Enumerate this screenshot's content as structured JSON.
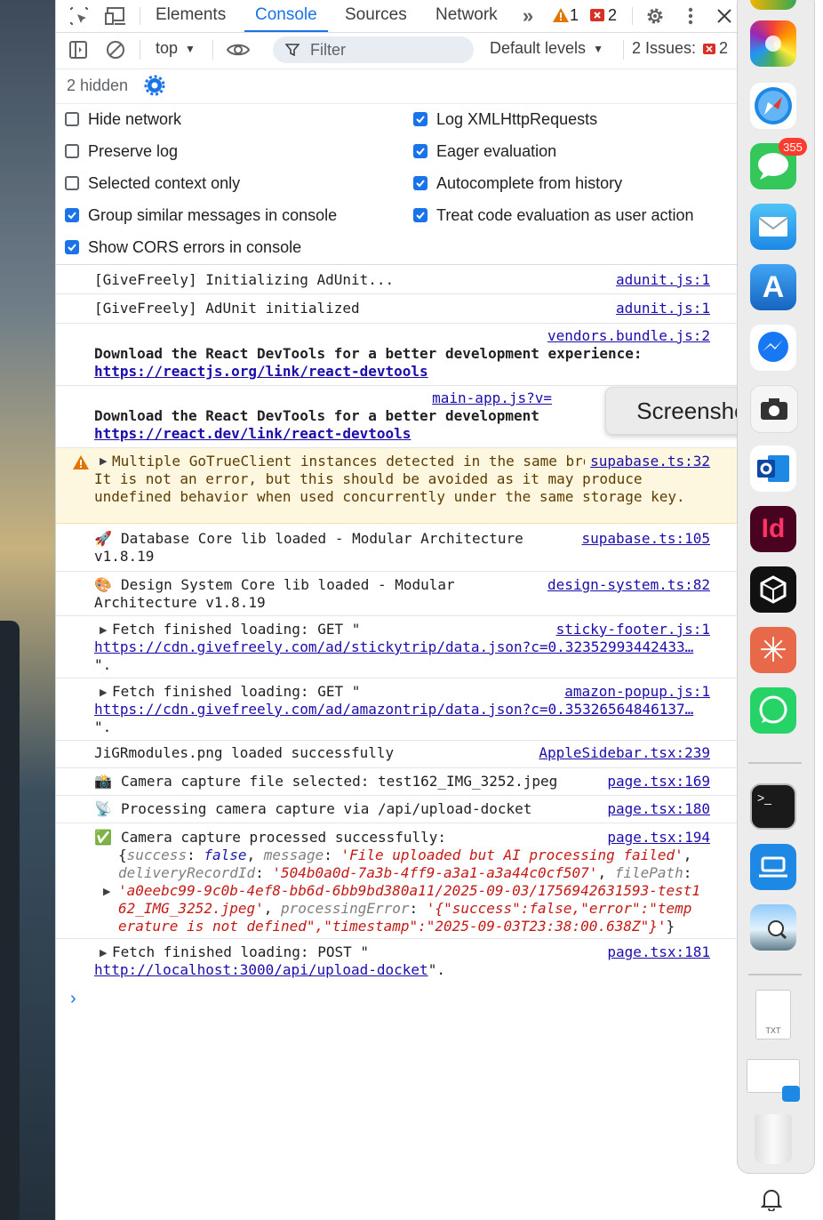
{
  "tabs": [
    "Elements",
    "Console",
    "Sources",
    "Network"
  ],
  "counts": {
    "warnings": "1",
    "errors": "2"
  },
  "controls": {
    "context": "top",
    "filter_placeholder": "Filter",
    "levels": "Default levels",
    "issues_label": "2 Issues:",
    "issues_count": "2",
    "hidden": "2 hidden"
  },
  "settings": {
    "left": [
      {
        "label": "Hide network",
        "checked": false
      },
      {
        "label": "Preserve log",
        "checked": false
      },
      {
        "label": "Selected context only",
        "checked": false
      },
      {
        "label": "Group similar messages in console",
        "checked": true
      },
      {
        "label": "Show CORS errors in console",
        "checked": true
      }
    ],
    "right": [
      {
        "label": "Log XMLHttpRequests",
        "checked": true
      },
      {
        "label": "Eager evaluation",
        "checked": true
      },
      {
        "label": "Autocomplete from history",
        "checked": true
      },
      {
        "label": "Treat code evaluation as user action",
        "checked": true
      }
    ]
  },
  "messages": [
    {
      "text": "[GiveFreely] Initializing AdUnit...",
      "source": "adunit.js:1"
    },
    {
      "text": "[GiveFreely] AdUnit initialized",
      "source": "adunit.js:1"
    },
    {
      "source": "vendors.bundle.js:2",
      "bold": "Download the React DevTools for a better development experience:",
      "url": "https://reactjs.org/link/react-devtools"
    },
    {
      "source": "main-app.js?v=",
      "bold": "Download the React DevTools for a better development",
      "url": "https://react.dev/link/react-devtools"
    },
    {
      "text": "Multiple GoTrueClient instances detected in the same browser context. It is not an error, but this should be avoided as it may produce undefined behavior when used concurrently under the same storage key.",
      "source": "supabase.ts:32"
    },
    {
      "emoji": "🚀",
      "text": "Database Core lib loaded - Modular Architecture v1.8.19",
      "source": "supabase.ts:105"
    },
    {
      "emoji": "🎨",
      "text": "Design System Core lib loaded - Modular Architecture v1.8.19",
      "source": "design-system.ts:82"
    },
    {
      "text": "Fetch finished loading: GET \"",
      "url": "https://cdn.givefreely.com/ad/stickytrip/data.json?c=0.32352993442433…",
      "tail": "\".",
      "source": "sticky-footer.js:1"
    },
    {
      "text": "Fetch finished loading: GET \"",
      "url": "https://cdn.givefreely.com/ad/amazontrip/data.json?c=0.35326564846137…",
      "tail": "\".",
      "source": "amazon-popup.js:1"
    },
    {
      "text": "JiGRmodules.png loaded successfully",
      "source": "AppleSidebar.tsx:239"
    },
    {
      "emoji": "📸",
      "text": "Camera capture file selected: test162_IMG_3252.jpeg",
      "source": "page.tsx:169"
    },
    {
      "emoji": "📡",
      "text": "Processing camera capture via /api/upload-docket",
      "source": "page.tsx:180"
    },
    {
      "emoji": "✅",
      "text": "Camera capture processed successfully:",
      "source": "page.tsx:194",
      "obj": {
        "k1": "success",
        "v1": "false",
        "k2": "message",
        "v2": "'File uploaded but AI processing failed'",
        "k3": "deliveryRecordId",
        "v3": "'504b0a0d-7a3b-4ff9-a3a1-a3a44c0cf507'",
        "k4": "filePath",
        "v4a": "'a0eebc99-9c0b-4ef8-bb6d-6bb9bd380a11/2025-09-03/1756942631593-test1",
        "v4b": "62_IMG_3252.jpeg'",
        "k5": "processingError",
        "v5a": "'{\"success\":false,\"error\":\"temp",
        "v5b": "erature is not defined\",\"timestamp\":\"2025-09-03T23:38:00.638Z\"}'"
      }
    },
    {
      "text": "Fetch finished loading: POST \"",
      "url": "http://localhost:3000/api/upload-docket",
      "tail": "\".",
      "source": "page.tsx:181"
    }
  ],
  "tooltip": "Screenshot",
  "dock": {
    "messages_badge": "355"
  },
  "colors": {
    "accent": "#1a73e8",
    "link": "#1a0dab",
    "warning_bg": "#fef7e0",
    "error": "#d93025",
    "warning": "#e37400"
  }
}
